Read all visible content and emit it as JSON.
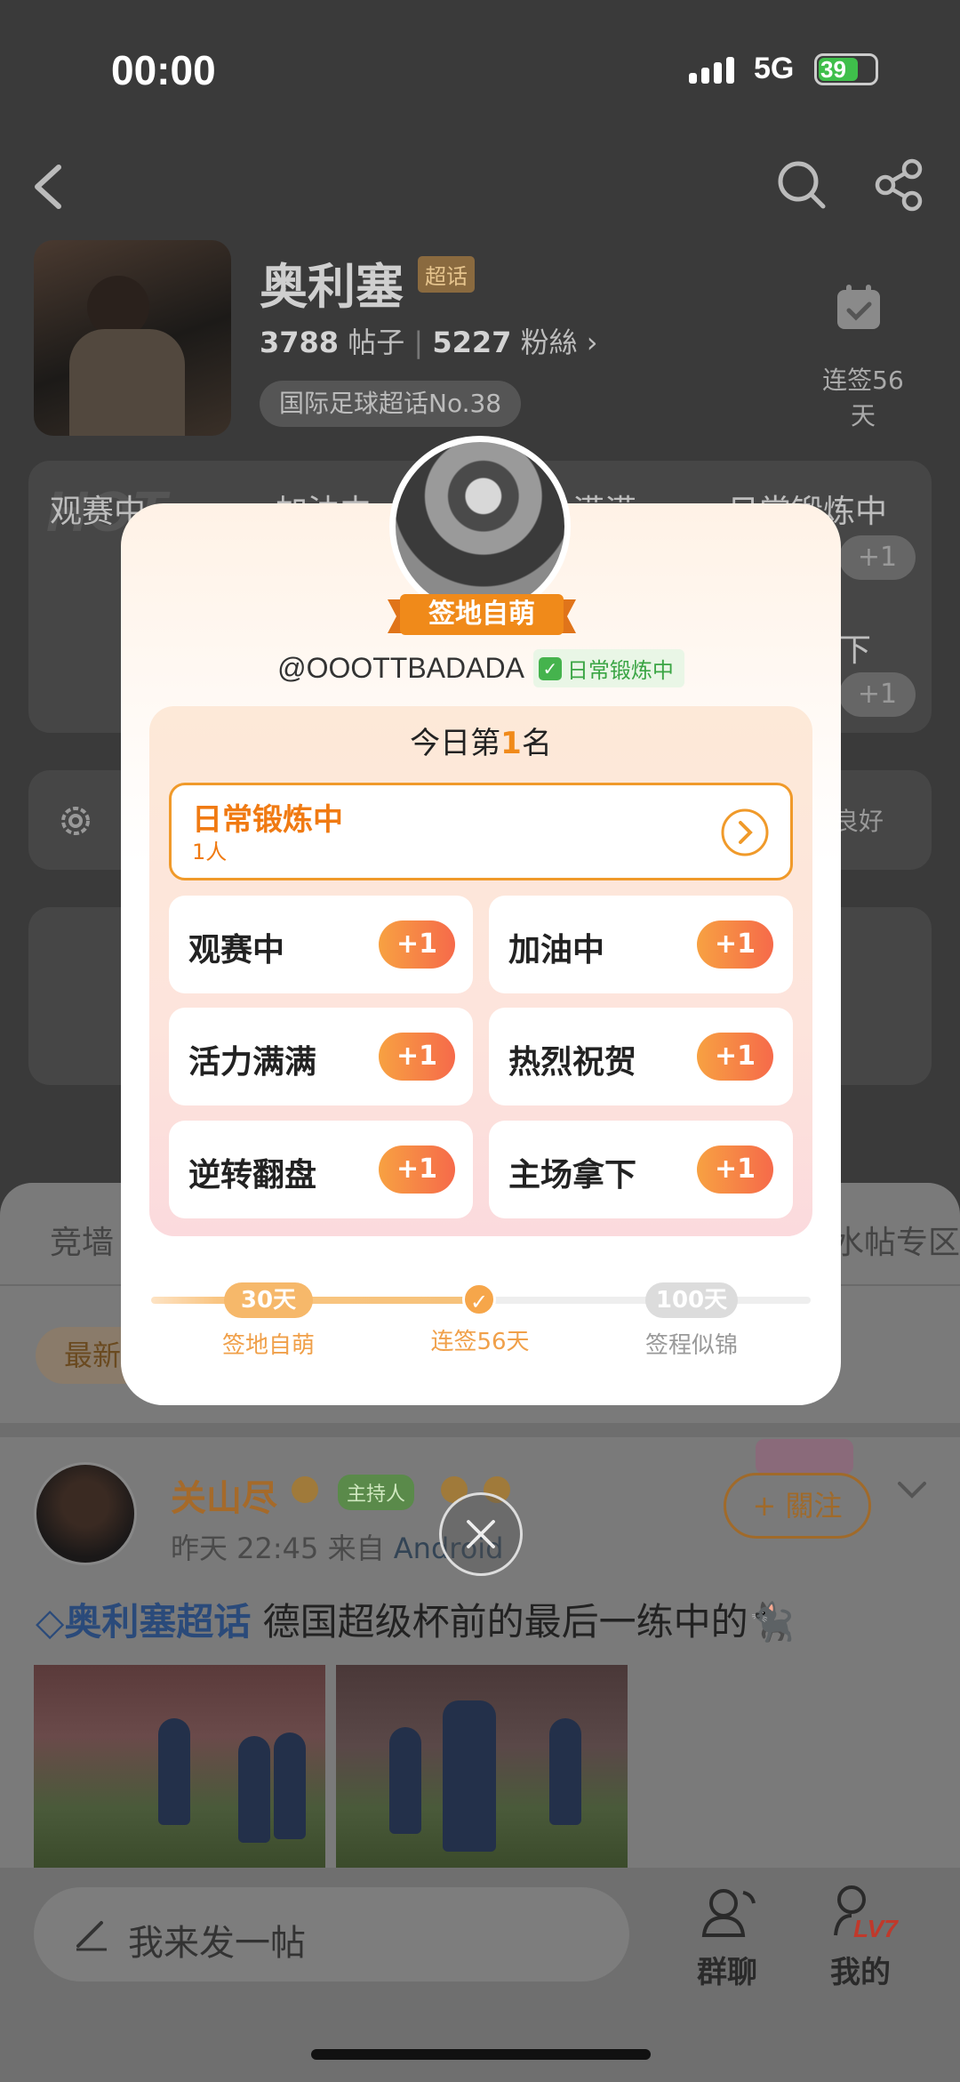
{
  "status_bar": {
    "time": "00:00",
    "network": "5G",
    "battery": "39"
  },
  "topic": {
    "title": "奥利塞",
    "badge": "超话",
    "posts_count": "3788",
    "posts_label": "帖子",
    "fans_count": "5227",
    "fans_label": "粉絲",
    "rank": "国际足球超话No.38",
    "checkin_label": "连签56天"
  },
  "background_cards": {
    "col1_label": "观赛中",
    "col2_label": "加油中",
    "col3_label": "满满",
    "col4_label": "日常锻炼中",
    "col4_row2": "下",
    "plus": "+1",
    "manage_right": "良好"
  },
  "modal": {
    "ribbon": "签地自萌",
    "handle": "@OOOTTBADADA",
    "status_tag": "日常锻炼中",
    "rank_prefix": "今日第",
    "rank_num": "1",
    "rank_suffix": "名",
    "selected": {
      "name": "日常锻炼中",
      "count": "1人"
    },
    "options": [
      {
        "label": "观赛中",
        "plus": "+1"
      },
      {
        "label": "加油中",
        "plus": "+1"
      },
      {
        "label": "活力满满",
        "plus": "+1"
      },
      {
        "label": "热烈祝贺",
        "plus": "+1"
      },
      {
        "label": "逆转翻盘",
        "plus": "+1"
      },
      {
        "label": "主场拿下",
        "plus": "+1"
      }
    ],
    "milestones": [
      {
        "badge": "30天",
        "label": "签地自萌"
      },
      {
        "badge": "",
        "label": "连签56天"
      },
      {
        "badge": "100天",
        "label": "签程似锦"
      }
    ],
    "progress_fraction": 0.52
  },
  "feed": {
    "tab_left": "竞墙",
    "tab_right": "水帖专区",
    "sort": "最新",
    "post": {
      "author": "关山尽",
      "host_badge": "主持人",
      "time": "昨天 22:45",
      "from": "来自",
      "source": "Android",
      "follow": "+ 關注",
      "topic_tag": "奥利塞超话",
      "text": " 德国超级杯前的最后一练中的🐈‍⬛"
    }
  },
  "bottom": {
    "compose": "我来发一帖",
    "group": "群聊",
    "me": "我的",
    "level": "LV7"
  },
  "colors": {
    "accent": "#f08a1a",
    "plus_gradient_start": "#f7a142",
    "plus_gradient_end": "#f66a4a",
    "status_green": "#3aa544"
  }
}
